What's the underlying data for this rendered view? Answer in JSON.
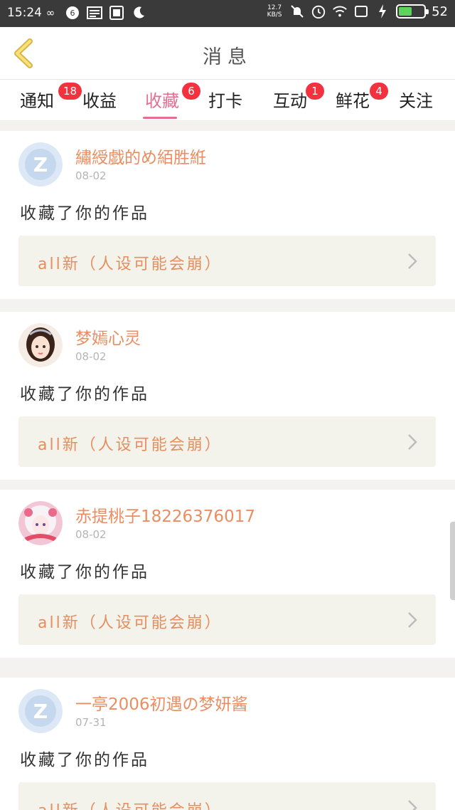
{
  "status_bar": {
    "time": "15:24",
    "net_speed": "12.7\nKB/S",
    "battery_percent": "52",
    "battery_level": 0.52,
    "left_icons": [
      "infinity-icon",
      "app-icon",
      "news-icon",
      "photo-icon",
      "moon-icon"
    ],
    "right_icons": [
      "mute-icon",
      "alarm-icon",
      "wifi-icon",
      "screen-icon",
      "charging-icon"
    ]
  },
  "header": {
    "title": "消息",
    "back_icon": "back-chevron-icon",
    "accent_color": "#e46f91"
  },
  "tabs": [
    {
      "label": "通知",
      "badge": "18",
      "active": false
    },
    {
      "label": "收益",
      "badge": "",
      "active": false
    },
    {
      "label": "收藏",
      "badge": "6",
      "active": true
    },
    {
      "label": "打卡",
      "badge": "",
      "active": false
    },
    {
      "label": "互动",
      "badge": "1",
      "active": false
    },
    {
      "label": "鲜花",
      "badge": "4",
      "active": false
    },
    {
      "label": "关注",
      "badge": "",
      "active": false
    }
  ],
  "feed": {
    "items": [
      {
        "username": "繡綬戯的め絔胜絍",
        "date": "08-02",
        "action": "收藏了你的作品",
        "work_title": "all新（人设可能会崩）",
        "avatar": "default-z-avatar"
      },
      {
        "username": "梦嫣心灵",
        "date": "08-02",
        "action": "收藏了你的作品",
        "work_title": "all新（人设可能会崩）",
        "avatar": "girl-avatar"
      },
      {
        "username": "赤提桃子18226376017",
        "date": "08-02",
        "action": "收藏了你的作品",
        "work_title": "all新（人设可能会崩）",
        "avatar": "anime-avatar"
      },
      {
        "username": "一亭2006初遇の梦妍酱",
        "date": "07-31",
        "action": "收藏了你的作品",
        "work_title": "all新（人设可能会崩）",
        "avatar": "default-z-avatar"
      }
    ]
  }
}
